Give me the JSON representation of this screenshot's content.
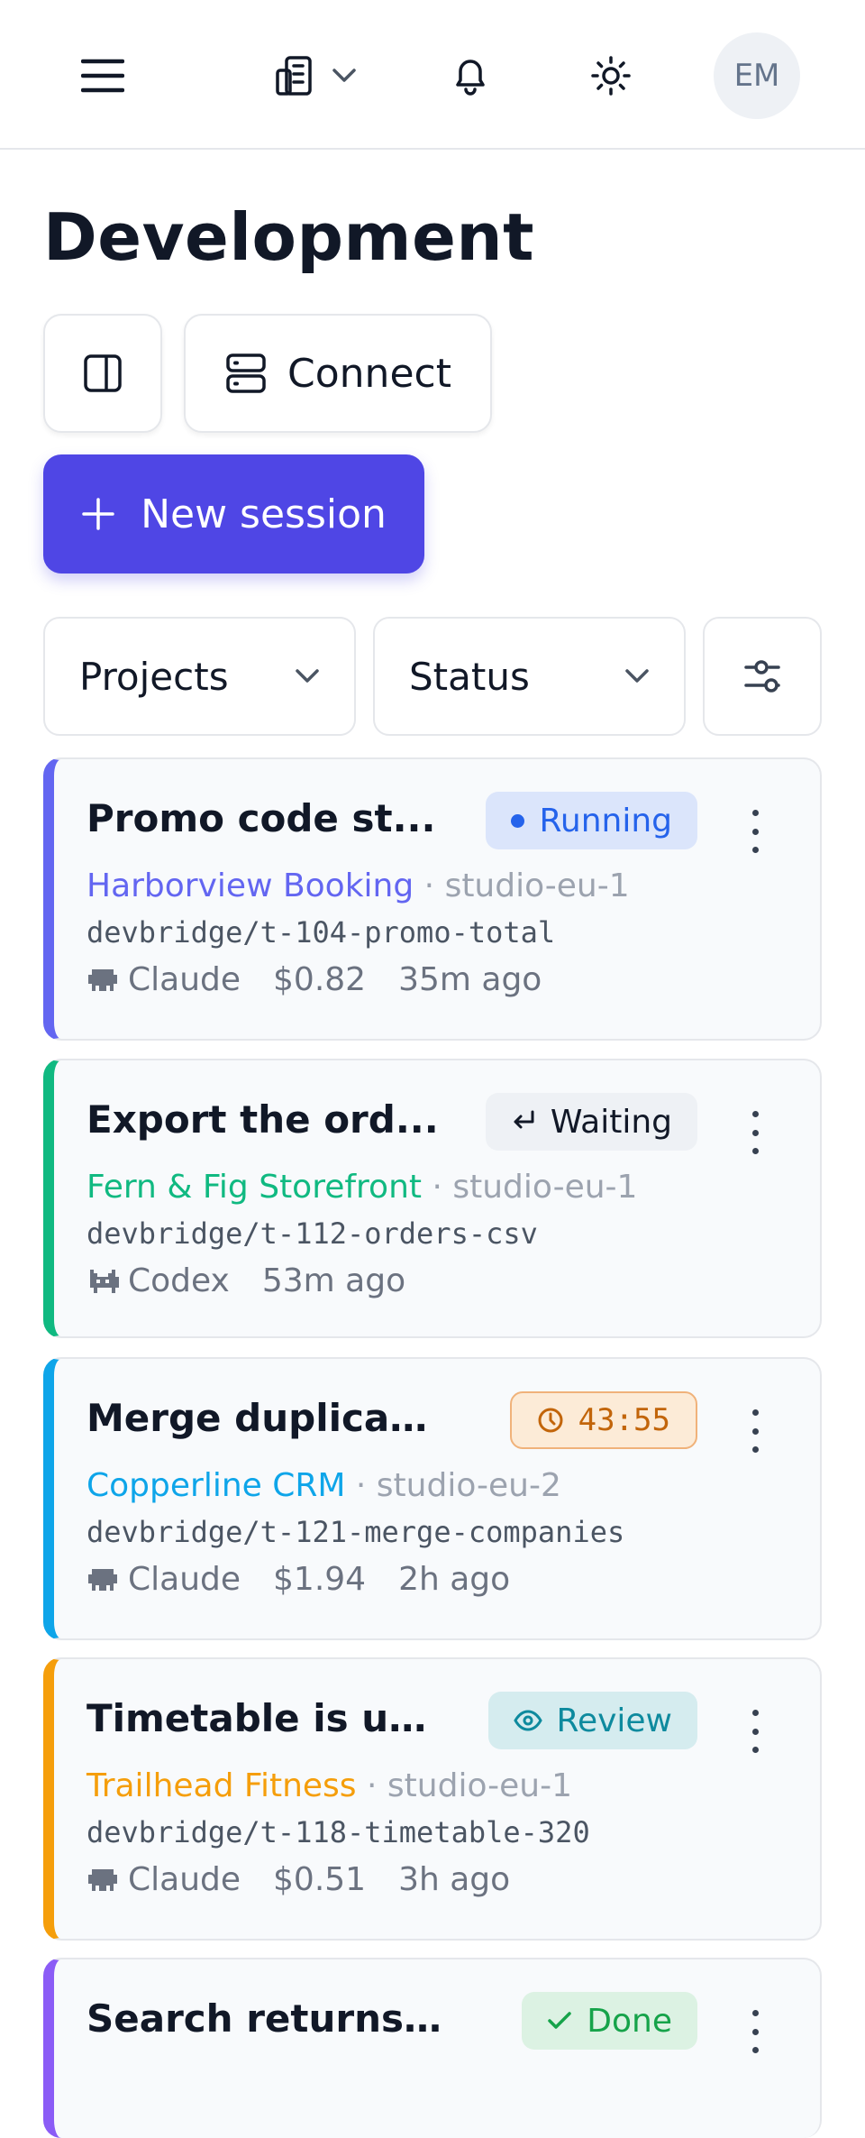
{
  "header": {
    "avatar_initials": "EM",
    "icons": {
      "menu": "menu-icon",
      "workspace": "document-building-icon",
      "workspace_dropdown": "chevron-down-icon",
      "notifications": "bell-icon",
      "theme": "sun-icon"
    }
  },
  "page": {
    "title": "Development",
    "sidebar_toggle_icon": "panel-right-icon",
    "connect_label": "Connect",
    "connect_icon": "server-icon",
    "new_session_label": "New session",
    "new_session_icon": "plus-icon"
  },
  "filters": {
    "projects_label": "Projects",
    "status_label": "Status",
    "settings_icon": "sliders-icon"
  },
  "colors": {
    "primary": "#4f46e5",
    "card_bg": "#f8fafc",
    "border": "#e5e7eb"
  },
  "sessions": [
    {
      "title": "Promo code st...",
      "status": "Running",
      "status_icon": "dot-icon",
      "project": "Harborview Booking",
      "project_color": "#6366f1",
      "server": "studio-eu-1",
      "branch": "devbridge/t-104-promo-total",
      "agent": "Claude",
      "cost": "$0.82",
      "time": "35m ago"
    },
    {
      "title": "Export the ord...",
      "status": "Waiting",
      "status_icon": "return-arrow-icon",
      "project": "Fern & Fig Storefront",
      "project_color": "#10b981",
      "server": "studio-eu-1",
      "branch": "devbridge/t-112-orders-csv",
      "agent": "Codex",
      "cost": "",
      "time": "53m ago"
    },
    {
      "title": "Merge duplicate...",
      "status": "43:55",
      "status_icon": "clock-icon",
      "project": "Copperline CRM",
      "project_color": "#0ea5e9",
      "server": "studio-eu-2",
      "branch": "devbridge/t-121-merge-companies",
      "agent": "Claude",
      "cost": "$1.94",
      "time": "2h ago"
    },
    {
      "title": "Timetable is un...",
      "status": "Review",
      "status_icon": "eye-icon",
      "project": "Trailhead Fitness",
      "project_color": "#f59e0b",
      "server": "studio-eu-1",
      "branch": "devbridge/t-118-timetable-320",
      "agent": "Claude",
      "cost": "$0.51",
      "time": "3h ago"
    },
    {
      "title": "Search returns n...",
      "status": "Done",
      "status_icon": "check-icon",
      "project": "",
      "project_color": "#8b5cf6",
      "server": "",
      "branch": "",
      "agent": "",
      "cost": "",
      "time": ""
    }
  ]
}
